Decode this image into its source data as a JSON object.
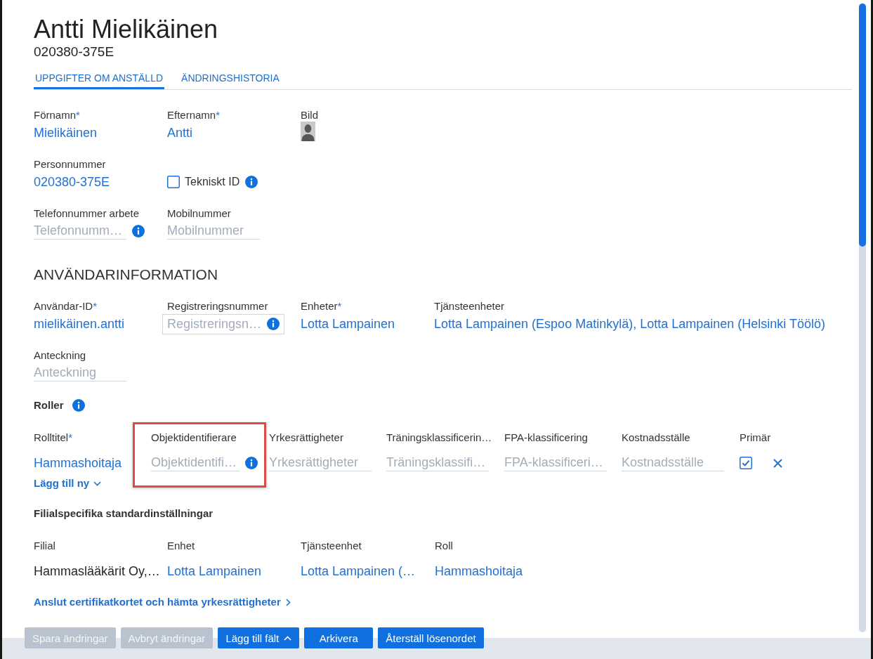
{
  "header": {
    "title": "Antti Mielikäinen",
    "subtitle": "020380-375E"
  },
  "tabs": [
    {
      "label": "UPPGIFTER OM ANSTÄLLD",
      "selected": true
    },
    {
      "label": "ÄNDRINGSHISTORIA",
      "selected": false
    }
  ],
  "employee": {
    "rows": [
      [
        {
          "kind": "value",
          "label": "Förnamn",
          "required_mark": "*",
          "value": "Mielikäinen"
        },
        {
          "kind": "value",
          "label": "Efternamn",
          "required_mark": "*",
          "value": "Antti"
        },
        {
          "kind": "photo",
          "label": "Bild"
        }
      ],
      [
        {
          "kind": "value",
          "label": "Personnummer",
          "value": "020380-375E"
        },
        {
          "kind": "checkbox",
          "text": "Tekniskt ID",
          "checked": false,
          "info": true
        }
      ],
      [
        {
          "kind": "input",
          "label": "Telefonnummer arbete",
          "placeholder": "Telefonnumm…",
          "info": true
        },
        {
          "kind": "input",
          "label": "Mobilnummer",
          "placeholder": "Mobilnummer"
        }
      ]
    ]
  },
  "user_info": {
    "title": "ANVÄNDARINFORMATION",
    "rows": [
      [
        {
          "kind": "value",
          "label": "Användar-ID",
          "required_mark": "*",
          "value": "mielikäinen.antti"
        },
        {
          "kind": "boxed-input",
          "label": "Registreringsnummer",
          "placeholder": "Registreringsn…",
          "info": true
        },
        {
          "kind": "value",
          "label": "Enheter",
          "required_mark": "*",
          "value": "Lotta Lampainen"
        },
        {
          "kind": "value",
          "label": "Tjänsteenheter",
          "value": "Lotta Lampainen (Espoo Matinkylä), Lotta Lampainen (Helsinki Töölö)"
        }
      ],
      [
        {
          "kind": "input",
          "label": "Anteckning",
          "placeholder": "Anteckning"
        }
      ]
    ]
  },
  "roles": {
    "title": "Roller",
    "info": true,
    "columns": [
      {
        "label": "Rolltitel",
        "required_mark": "*",
        "highlighted": false
      },
      {
        "label": "Objektidentifierare",
        "highlighted": true
      },
      {
        "label": "Yrkesrättigheter",
        "highlighted": false
      },
      {
        "label": "Träningsklassificerin…",
        "highlighted": false
      },
      {
        "label": "FPA-klassificering",
        "highlighted": false
      },
      {
        "label": "Kostnadsställe",
        "highlighted": false
      },
      {
        "label": "Primär",
        "highlighted": false
      }
    ],
    "rows": [
      {
        "cells": [
          {
            "kind": "value",
            "value": "Hammashoitaja"
          },
          {
            "kind": "input",
            "placeholder": "Objektidentifi…",
            "info": true
          },
          {
            "kind": "input",
            "placeholder": "Yrkesrättigheter"
          },
          {
            "kind": "input",
            "placeholder": "Träningsklassifi…"
          },
          {
            "kind": "input",
            "placeholder": "FPA-klassificeri…"
          },
          {
            "kind": "input",
            "placeholder": "Kostnadsställe"
          },
          {
            "kind": "checkbox",
            "checked": true
          }
        ]
      }
    ],
    "add_button": "Lägg till ny"
  },
  "branch_defaults": {
    "title": "Filialspecifika standardinställningar",
    "columns": [
      "Filial",
      "Enhet",
      "Tjänsteenhet",
      "Roll"
    ],
    "rows": [
      [
        {
          "text": "Hammaslääkärit Oy,…",
          "link": false
        },
        {
          "text": "Lotta Lampainen",
          "link": true
        },
        {
          "text": "Lotta Lampainen (…",
          "link": true
        },
        {
          "text": "Hammashoitaja",
          "link": true
        }
      ]
    ]
  },
  "certificate_link": "Anslut certifikatkortet och hämta yrkesrättigheter",
  "footer": {
    "buttons": [
      {
        "label": "Spara ändringar",
        "disabled": true
      },
      {
        "label": "Avbryt ändringar",
        "disabled": true
      },
      {
        "label": "Lägg till fält",
        "disabled": false,
        "has_menu": true
      },
      {
        "label": "Arkivera",
        "disabled": false
      },
      {
        "label": "Återställ lösenordet",
        "disabled": false
      }
    ]
  }
}
